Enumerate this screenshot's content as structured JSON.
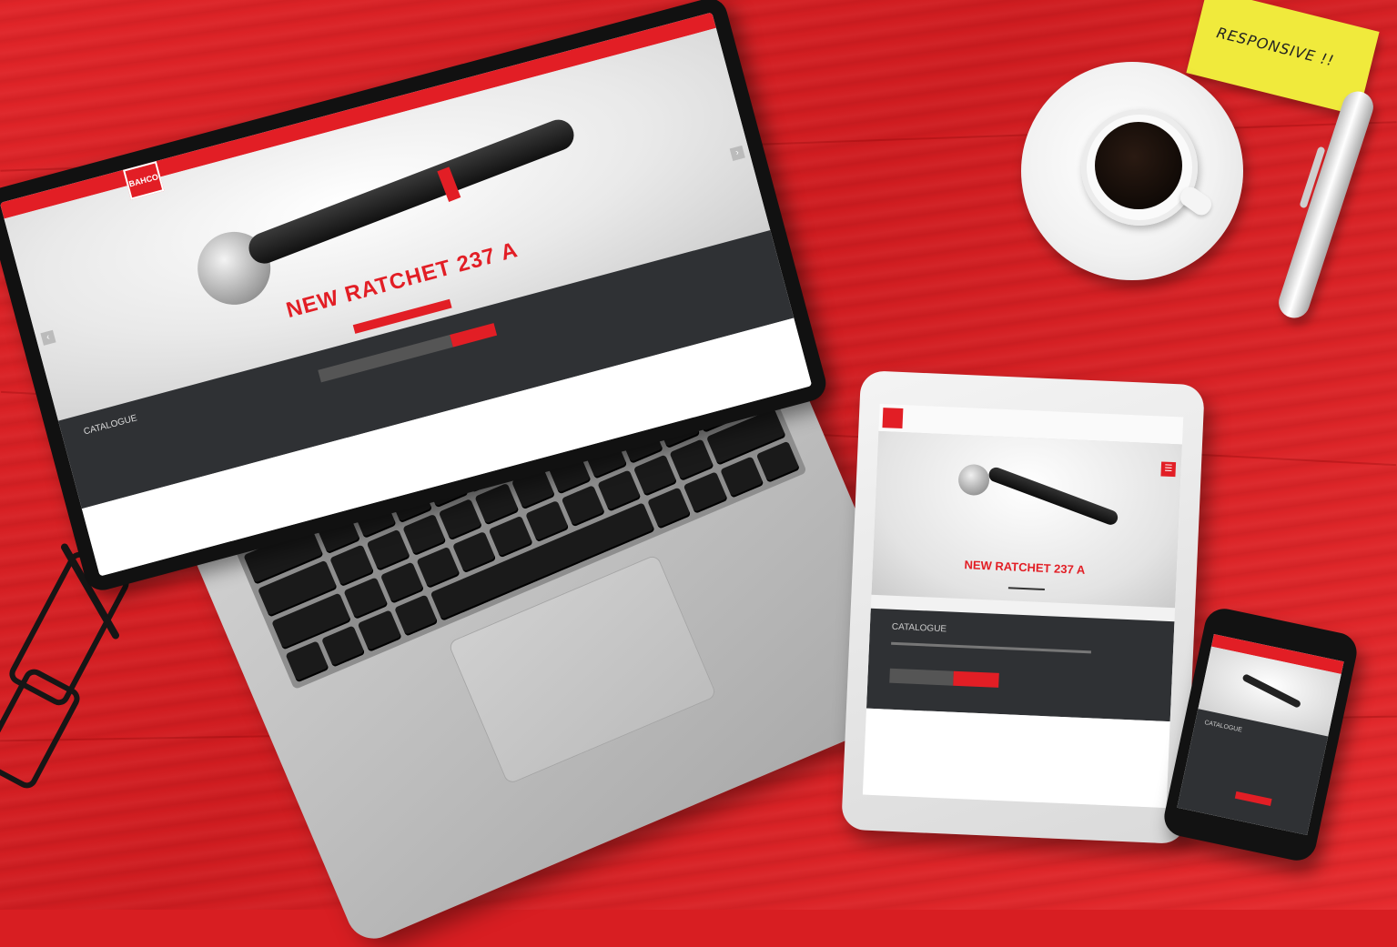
{
  "sticky_note": {
    "text": "RESPONSIVE !!"
  },
  "laptop": {
    "site_logo": "BAHCO",
    "hero_title": "NEW RATCHET 237 A",
    "section_label": "CATALOGUE"
  },
  "tablet": {
    "hero_title": "NEW RATCHET 237 A",
    "section_label": "CATALOGUE"
  },
  "phone": {
    "section_label": "CATALOGUE"
  },
  "colors": {
    "brand_red": "#e21e25",
    "desk_red": "#d81e22",
    "dark_band": "#2f3134"
  },
  "icons": [
    "menu-icon",
    "arrow-left-icon",
    "arrow-right-icon"
  ]
}
